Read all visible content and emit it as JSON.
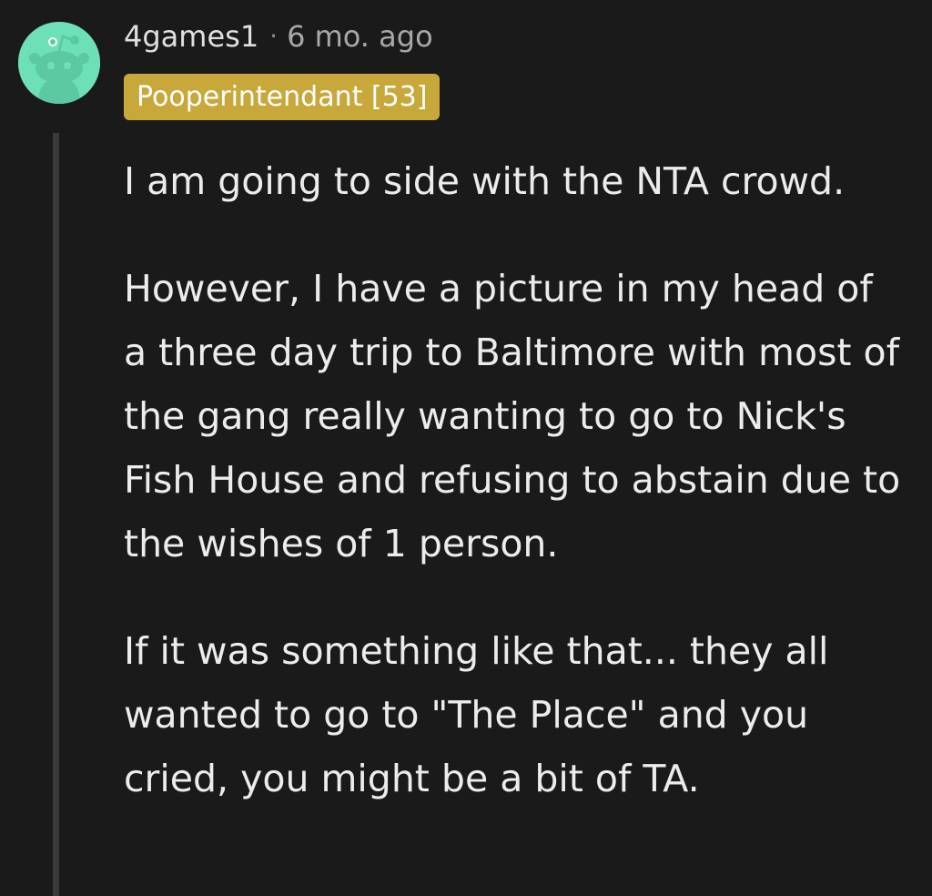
{
  "comment": {
    "username": "4games1",
    "separator": "·",
    "timestamp": "6 mo. ago",
    "flair": "Pooperintendant [53]",
    "avatar_icon": "reddit-snoo-avatar-icon",
    "paragraphs": [
      "I am going to side with the NTA crowd.",
      "However, I have a picture in my head of a three day trip to Baltimore with most of the gang really wanting to go to Nick's Fish House and refusing to abstain due to the wishes of 1 person.",
      "If it was something like that... they all wanted to go to \"The Place\" and you cried, you might be a bit of TA."
    ]
  },
  "colors": {
    "background": "#1a1a1b",
    "avatar_bg": "#6ee0b8",
    "flair_bg": "#c9a83b",
    "thread_line": "#3a3a3c"
  }
}
